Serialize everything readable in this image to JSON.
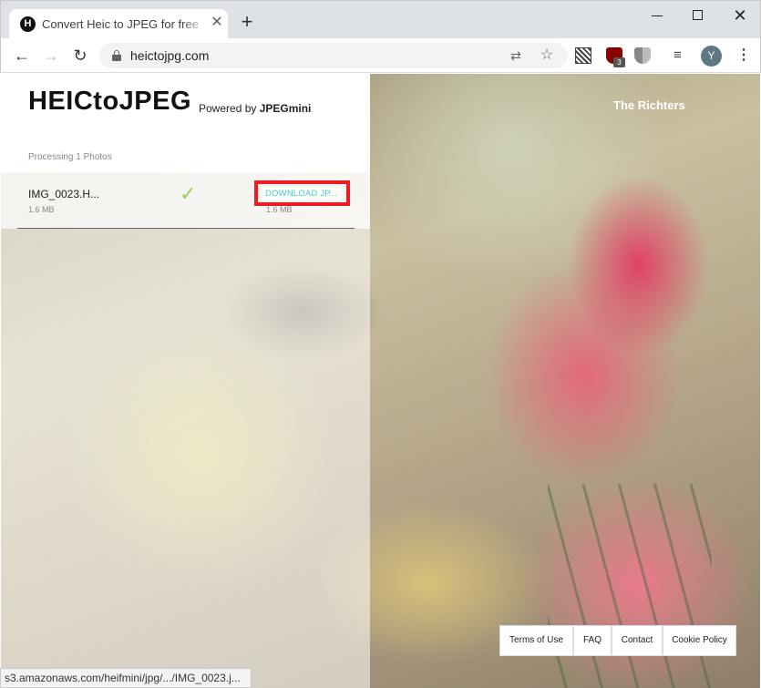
{
  "browser": {
    "tab": {
      "favicon_letter": "H",
      "title": "Convert Heic to JPEG for free | HEIC",
      "close": "✕"
    },
    "new_tab": "+",
    "window": {
      "close": "✕"
    },
    "nav": {
      "back": "←",
      "forward": "→",
      "reload": "↻"
    },
    "url": "heictojpg.com",
    "icons": {
      "translate": "⇄",
      "star": "☆",
      "media": "≡",
      "menu": "⋮"
    },
    "ublock_badge": "3",
    "avatar_letter": "Y",
    "status_url": "s3.amazonaws.com/heifmini/jpg/.../IMG_0023.j..."
  },
  "panel": {
    "logo": "HEICtoJPEG",
    "powered_prefix": "Powered by ",
    "powered_brand": "JPEGmini",
    "processing": "Processing 1 Photos",
    "file": {
      "name": "IMG_0023.H...",
      "size": "1.6 MB",
      "check": "✓",
      "download_label": "DOWNLOAD JP...",
      "download_size": "1.6 MB"
    }
  },
  "photo": {
    "credit": "The Richters"
  },
  "footer": {
    "terms": "Terms of Use",
    "faq": "FAQ",
    "contact": "Contact",
    "cookie": "Cookie Policy"
  },
  "colors": {
    "accent": "#3fd0c9",
    "highlight": "#ed1c24",
    "check": "#9ccc65"
  }
}
